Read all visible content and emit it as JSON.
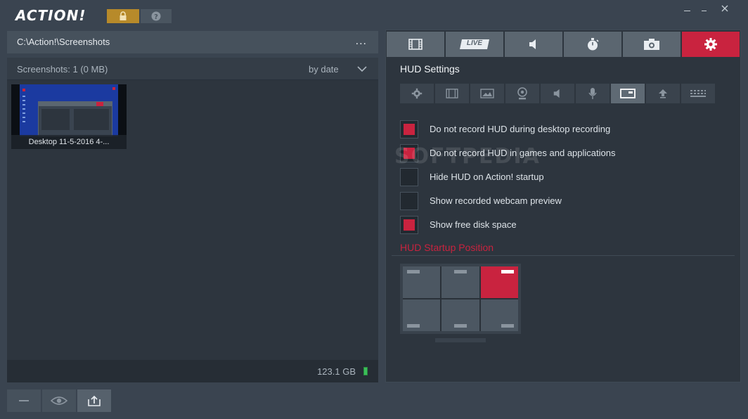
{
  "app": {
    "logo_text": "ACTION!"
  },
  "left": {
    "path": "C:\\Action!\\Screenshots",
    "more": "...",
    "count_label": "Screenshots: 1 (0 MB)",
    "sort_label": "by date",
    "thumbnails": [
      {
        "label": "Desktop 11-5-2016 4-..."
      }
    ],
    "free_space": "123.1 GB"
  },
  "right": {
    "tabs": [
      {
        "icon": "film-icon",
        "active": false
      },
      {
        "label": "LIVE",
        "icon": "live-icon",
        "active": false
      },
      {
        "icon": "speaker-icon",
        "active": false
      },
      {
        "icon": "stopwatch-icon",
        "active": false
      },
      {
        "icon": "camera-icon",
        "active": false
      },
      {
        "icon": "gear-icon",
        "active": true
      }
    ],
    "section_title": "HUD Settings",
    "subtabs": [
      "gear-icon",
      "film-icon",
      "image-icon",
      "webcam-icon",
      "speaker-icon",
      "microphone-icon",
      "hud-icon",
      "upload-icon",
      "keyboard-icon"
    ],
    "active_subtab": 6,
    "options": [
      {
        "label": "Do not record HUD during desktop recording",
        "checked": true
      },
      {
        "label": "Do not record HUD in games and applications",
        "checked": true
      },
      {
        "label": "Hide HUD on Action! startup",
        "checked": false
      },
      {
        "label": "Show recorded webcam preview",
        "checked": false
      },
      {
        "label": "Show free disk space",
        "checked": true
      }
    ],
    "watermark": "SOFTPEDIA",
    "startup_position_title": "HUD Startup Position",
    "startup_position_selected": "top-right"
  },
  "colors": {
    "accent": "#c9233f",
    "lock": "#b78a2a",
    "background": "#3a4450",
    "panel": "#2d353e"
  }
}
